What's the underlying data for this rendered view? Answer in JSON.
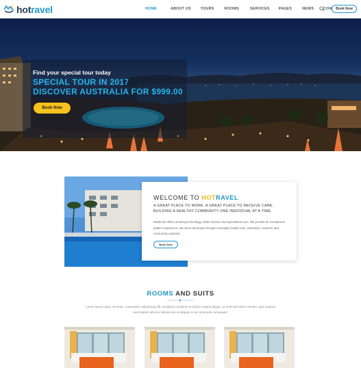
{
  "header": {
    "logo_text_a": "hot",
    "logo_text_b": "ravel",
    "nav": [
      {
        "label": "HOME",
        "active": true
      },
      {
        "label": "ABOUT US",
        "active": false
      },
      {
        "label": "TOURS",
        "active": false
      },
      {
        "label": "ROOMS",
        "active": false
      },
      {
        "label": "SERVICES",
        "active": false
      },
      {
        "label": "PAGES",
        "active": false
      },
      {
        "label": "NEWS",
        "active": false
      },
      {
        "label": "CONTACT",
        "active": false
      }
    ],
    "search_icon": "search-icon",
    "book_label": "Book Now"
  },
  "hero": {
    "subtitle": "Find your special tour today",
    "title_line1": "SPECIAL TOUR IN 2017",
    "title_line2": "DISCOVER AUSTRALIA FOR $999.00",
    "button_label": "Book Now"
  },
  "welcome": {
    "title_prefix": "WELCOME TO ",
    "brand_a": "HOT",
    "brand_b": "RAVEL",
    "lead": "A GREAT PLACE TO WORK. A GREAT PLACE TO RECEIVE CARE. BUILDING A HEALTHY COMMUNITY ONE INDIVIDUAL AT A TIME.",
    "body": "MediCare offers amazing technology, better doctors and specialized care. We provide an exceptional patient experience. We serve all people through exemplary health care, education, research and community outreach.",
    "button_label": "Book Now"
  },
  "rooms": {
    "title_highlight": "ROOMS",
    "title_rest": " AND SUITS",
    "description": "Lorem ipsum dolor sit amet, consectetur adipisicing elit, incididunt ut labore et dolore magna aliqua. Ut enim ad minim veniam, quis nostrud exercitation ullamco laboris nisi ut aliquip ex ea commodo consequat."
  },
  "colors": {
    "accent": "#2196c9",
    "highlight": "#27b4e6",
    "button_yellow": "#f6c21b",
    "brand_yellow": "#f0b418"
  }
}
